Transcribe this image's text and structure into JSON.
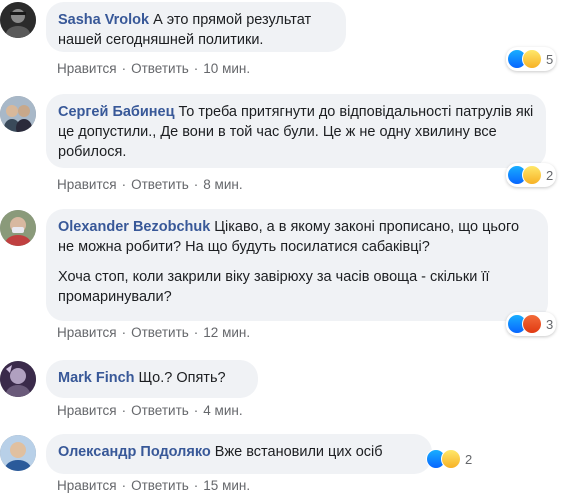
{
  "comments": [
    {
      "author": "Sasha Vrolok",
      "paragraphs": [
        "А это прямой результат нашей сегодняшней политики."
      ],
      "like": "Нравится",
      "reply": "Ответить",
      "time": "10 мин.",
      "reaction_count": "5",
      "reaction_icons": [
        "like-icon",
        "haha-icon"
      ],
      "avatar_color": "#3a3a3a"
    },
    {
      "author": "Сергей Бабинец",
      "paragraphs": [
        "То треба притягнути до відповідальності патрулів які це допустили., Де вони в той час були. Це ж не одну хвилину все робилося."
      ],
      "like": "Нравится",
      "reply": "Ответить",
      "time": "8 мин.",
      "reaction_count": "2",
      "reaction_icons": [
        "like-icon",
        "haha-icon"
      ],
      "avatar_color": "#7a8a9a"
    },
    {
      "author": "Olexander Bezobchuk",
      "paragraphs": [
        "Цікаво, а в якому законі прописано, що цього не можна робити? На що будуть посилатися сабаківці?",
        "Хоча стоп, коли закрили віку завірюху за часів овоща - скільки її промаринували?"
      ],
      "like": "Нравится",
      "reply": "Ответить",
      "time": "12 мин.",
      "reaction_count": "3",
      "reaction_icons": [
        "like-icon",
        "angry-icon"
      ],
      "avatar_color": "#6b7a5a"
    },
    {
      "author": "Mark Finch",
      "paragraphs": [
        "Що.? Опять?"
      ],
      "like": "Нравится",
      "reply": "Ответить",
      "time": "4 мин.",
      "reaction_count": "",
      "reaction_icons": [],
      "avatar_color": "#4a3a5a"
    },
    {
      "author": "Олександр Подоляко",
      "paragraphs": [
        "Вже встановили цих осіб"
      ],
      "like": "Нравится",
      "reply": "Ответить",
      "time": "15 мин.",
      "reaction_count": "2",
      "reaction_icons": [
        "like-icon",
        "wow-icon"
      ],
      "avatar_color": "#4a7ab0"
    }
  ],
  "colors": {
    "author": "#385898",
    "bubble": "#f0f2f5",
    "meta": "#65676b"
  }
}
